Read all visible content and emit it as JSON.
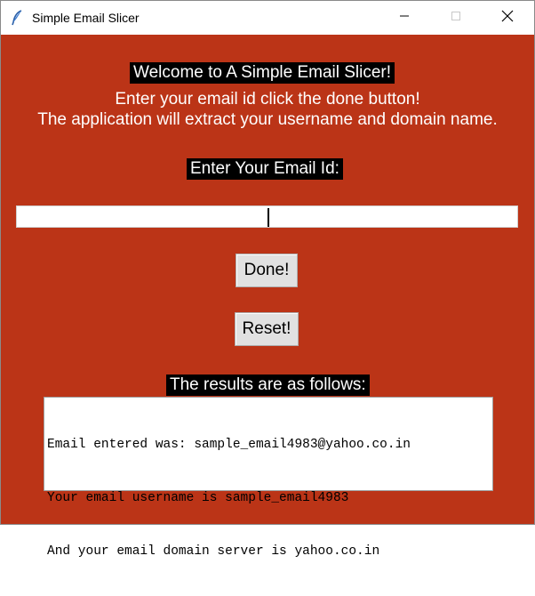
{
  "window": {
    "title": "Simple Email Slicer",
    "icon": "feather-icon",
    "controls": [
      "minimize-icon",
      "maximize-icon",
      "close-icon"
    ]
  },
  "header": {
    "welcome": "Welcome to A Simple Email Slicer!",
    "instruction_1": "Enter your email id click the done button!",
    "instruction_2": "The application will extract your username and domain name."
  },
  "form": {
    "email_label": "Enter Your Email Id:",
    "email_value": "",
    "done_label": "Done!",
    "reset_label": "Reset!"
  },
  "results": {
    "label": "The results are as follows:",
    "lines": [
      "Email entered was: sample_email4983@yahoo.co.in",
      "Your email username is sample_email4983",
      "And your email domain server is yahoo.co.in"
    ]
  },
  "colors": {
    "background": "#bb3417",
    "label_background": "#000000",
    "text": "#ffffff"
  }
}
